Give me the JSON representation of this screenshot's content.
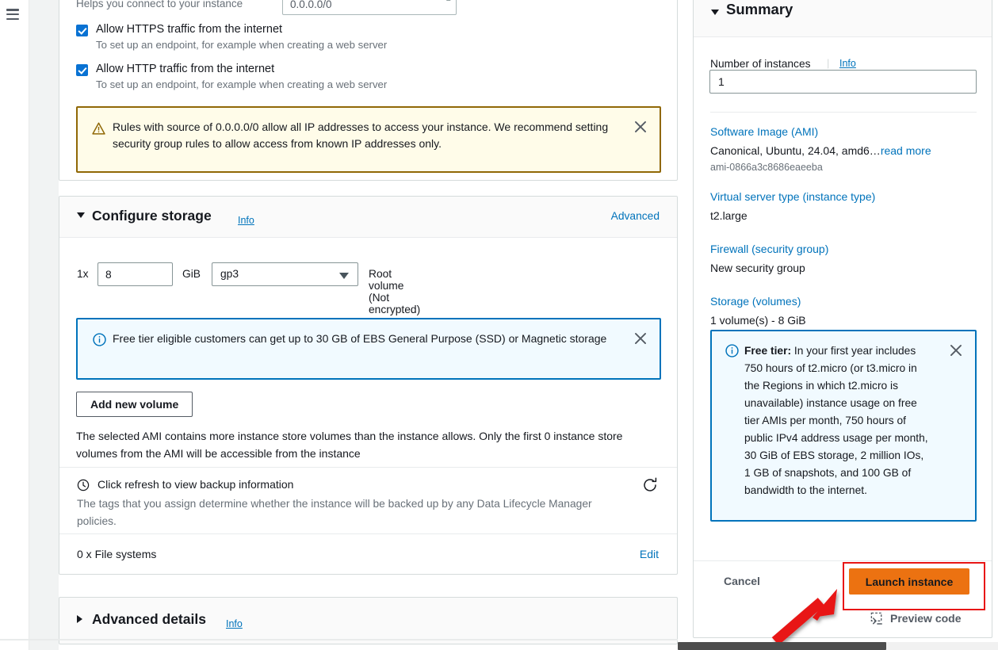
{
  "nav": {
    "menu_icon": "hamburger-menu-icon"
  },
  "security_group": {
    "helper_text": "Helps you connect to your instance",
    "source_value": "0.0.0.0/0",
    "checkboxes": [
      {
        "label": "Allow HTTPS traffic from the internet",
        "description": "To set up an endpoint, for example when creating a web server",
        "checked": true
      },
      {
        "label": "Allow HTTP traffic from the internet",
        "description": "To set up an endpoint, for example when creating a web server",
        "checked": true
      }
    ],
    "warning": {
      "icon": "warning-triangle-icon",
      "text": "Rules with source of 0.0.0.0/0 allow all IP addresses to access your instance. We recommend setting security group rules to allow access from known IP addresses only.",
      "dismiss_icon": "close-icon"
    }
  },
  "storage": {
    "title": "Configure storage",
    "info_label": "Info",
    "advanced_label": "Advanced",
    "expanded": true,
    "volume": {
      "count_label": "1x",
      "size_value": "8",
      "unit_label": "GiB",
      "type_value": "gp3",
      "note": "Root volume  (Not encrypted)"
    },
    "info_alert": {
      "icon": "info-circle-icon",
      "text": "Free tier eligible customers can get up to 30 GB of EBS General Purpose (SSD) or Magnetic storage",
      "dismiss_icon": "close-icon"
    },
    "add_volume_label": "Add new volume",
    "instance_store_note": "The selected AMI contains more instance store volumes than the instance allows. Only the first 0 instance store volumes from the AMI will be accessible from the instance",
    "backup": {
      "icon": "clock-icon",
      "title": "Click refresh to view backup information",
      "description": "The tags that you assign determine whether the instance will be backed up by any Data Lifecycle Manager policies.",
      "refresh_icon": "refresh-icon"
    },
    "file_systems": {
      "label": "0 x File systems",
      "edit_label": "Edit"
    }
  },
  "advanced_details": {
    "title": "Advanced details",
    "info_label": "Info",
    "expanded": false
  },
  "summary": {
    "title": "Summary",
    "expanded": true,
    "number_of_instances": {
      "label": "Number of instances",
      "info_label": "Info",
      "value": "1"
    },
    "items": [
      {
        "link": "Software Image (AMI)",
        "value": "Canonical, Ubuntu, 24.04, amd6…",
        "read_more": "read more",
        "sub": "ami-0866a3c8686eaeeba"
      },
      {
        "link": "Virtual server type (instance type)",
        "value": "t2.large"
      },
      {
        "link": "Firewall (security group)",
        "value": "New security group"
      },
      {
        "link": "Storage (volumes)",
        "value": "1 volume(s) - 8 GiB"
      }
    ],
    "free_tier": {
      "icon": "info-circle-icon",
      "bold_prefix": "Free tier:",
      "text": " In your first year includes 750 hours of t2.micro (or t3.micro in the Regions in which t2.micro is unavailable) instance usage on free tier AMIs per month, 750 hours of public IPv4 address usage per month, 30 GiB of EBS storage, 2 million IOs, 1 GB of snapshots, and 100 GB of bandwidth to the internet.",
      "dismiss_icon": "close-icon"
    },
    "footer": {
      "cancel_label": "Cancel",
      "launch_label": "Launch instance",
      "preview_label": "Preview code",
      "preview_icon": "terminal-icon"
    }
  },
  "annotation": {
    "shape": "red-rectangle-and-arrow",
    "target": "Launch instance",
    "color": "#e81515"
  },
  "colors": {
    "accent_link": "#0073bb",
    "launch_button": "#ec7211",
    "warning_border": "#906806",
    "warning_background": "#fffce9",
    "info_border": "#0073bb",
    "info_background": "#f1faff",
    "checkbox": "#0972d3",
    "annotation": "#e81515"
  }
}
